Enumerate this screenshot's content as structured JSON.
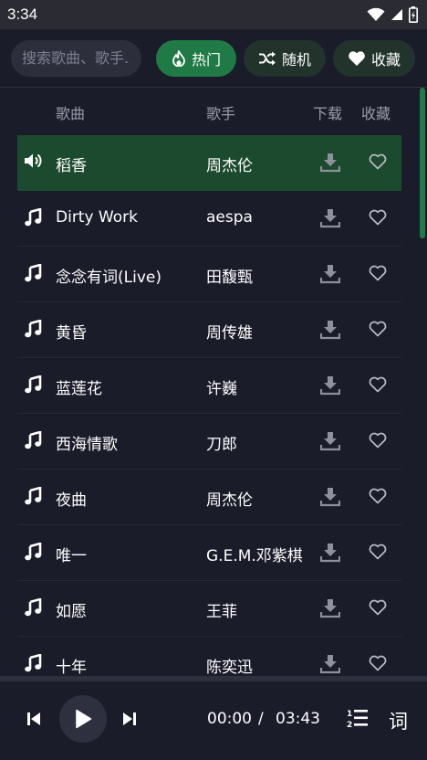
{
  "status": {
    "time": "3:34"
  },
  "search": {
    "placeholder": "搜索歌曲、歌手..."
  },
  "tabs": [
    {
      "label": "热门",
      "icon": "fire-icon",
      "active": true
    },
    {
      "label": "随机",
      "icon": "shuffle-icon",
      "active": false
    },
    {
      "label": "收藏",
      "icon": "heart-icon",
      "active": false
    }
  ],
  "columns": {
    "song": "歌曲",
    "artist": "歌手",
    "download": "下载",
    "favorite": "收藏"
  },
  "songs": [
    {
      "title": "稻香",
      "artist": "周杰伦",
      "playing": true
    },
    {
      "title": "Dirty Work",
      "artist": "aespa",
      "playing": false
    },
    {
      "title": "念念有词(Live)",
      "artist": "田馥甄",
      "playing": false
    },
    {
      "title": "黄昏",
      "artist": "周传雄",
      "playing": false
    },
    {
      "title": "蓝莲花",
      "artist": "许巍",
      "playing": false
    },
    {
      "title": "西海情歌",
      "artist": "刀郎",
      "playing": false
    },
    {
      "title": "夜曲",
      "artist": "周杰伦",
      "playing": false
    },
    {
      "title": "唯一",
      "artist": "G.E.M.邓紫棋",
      "playing": false
    },
    {
      "title": "如愿",
      "artist": "王菲",
      "playing": false
    },
    {
      "title": "十年",
      "artist": "陈奕迅",
      "playing": false
    }
  ],
  "player": {
    "current_time": "00:00",
    "separator": "/",
    "total_time": "03:43",
    "lyrics_label": "词"
  },
  "colors": {
    "accent": "#1f7a45",
    "playing_row": "#1c4a2e",
    "background": "#1a1c2a"
  }
}
